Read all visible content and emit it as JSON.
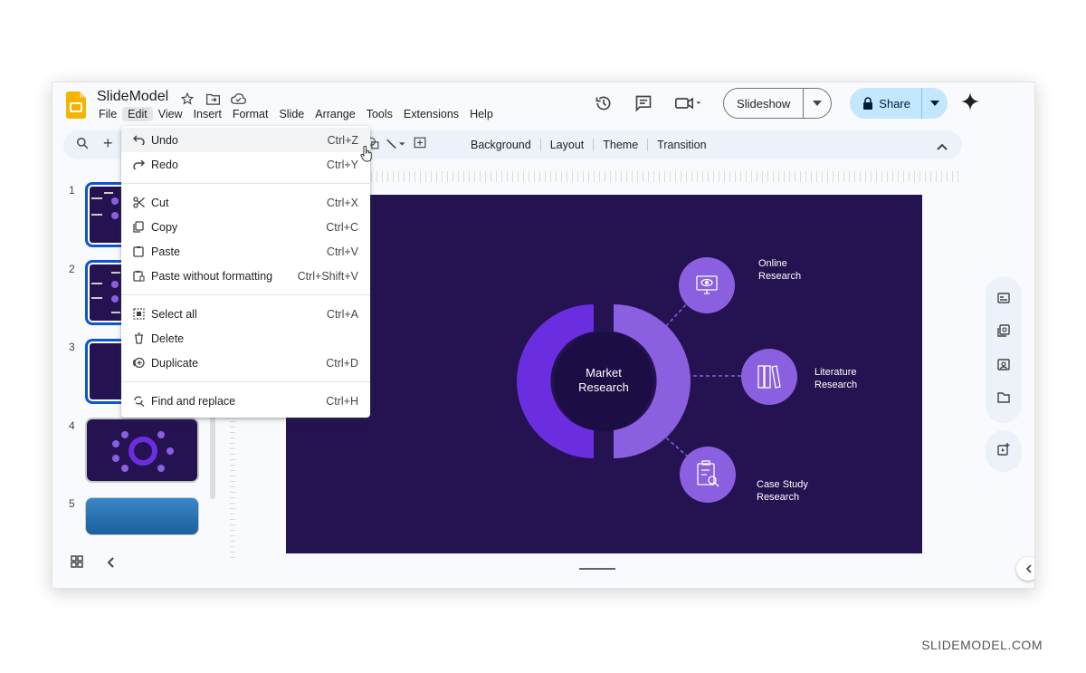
{
  "header": {
    "title": "SlideModel",
    "menu": [
      "File",
      "Edit",
      "View",
      "Insert",
      "Format",
      "Slide",
      "Arrange",
      "Tools",
      "Extensions",
      "Help"
    ],
    "slideshow_label": "Slideshow",
    "share_label": "Share"
  },
  "toolbar": {
    "items": [
      "Background",
      "Layout",
      "Theme",
      "Transition"
    ]
  },
  "edit_menu": {
    "items": [
      {
        "label": "Undo",
        "shortcut": "Ctrl+Z",
        "icon": "undo-icon"
      },
      {
        "label": "Redo",
        "shortcut": "Ctrl+Y",
        "icon": "redo-icon"
      },
      {
        "label": "Cut",
        "shortcut": "Ctrl+X",
        "icon": "scissors-icon"
      },
      {
        "label": "Copy",
        "shortcut": "Ctrl+C",
        "icon": "copy-icon"
      },
      {
        "label": "Paste",
        "shortcut": "Ctrl+V",
        "icon": "clipboard-icon"
      },
      {
        "label": "Paste without formatting",
        "shortcut": "Ctrl+Shift+V",
        "icon": "clipboard-plain-icon"
      },
      {
        "label": "Select all",
        "shortcut": "Ctrl+A",
        "icon": "select-all-icon"
      },
      {
        "label": "Delete",
        "shortcut": "",
        "icon": "trash-icon"
      },
      {
        "label": "Duplicate",
        "shortcut": "Ctrl+D",
        "icon": "duplicate-icon"
      },
      {
        "label": "Find and replace",
        "shortcut": "Ctrl+H",
        "icon": "find-replace-icon"
      }
    ]
  },
  "filmstrip": {
    "numbers": [
      "1",
      "2",
      "3",
      "4",
      "5"
    ]
  },
  "slide": {
    "center_line1": "Market",
    "center_line2": "Research",
    "nodes": [
      {
        "line1": "Online",
        "line2": "Research"
      },
      {
        "line1": "Literature",
        "line2": "Research"
      },
      {
        "line1": "Case Study",
        "line2": "Research"
      }
    ]
  },
  "colors": {
    "slide_bg": "#241350",
    "donut_left": "#6a2ee0",
    "donut_right": "#8a5fe0",
    "node_fill": "#8a5fe0",
    "accent_blue": "#0b57d0"
  },
  "watermark": "SLIDEMODEL.COM"
}
